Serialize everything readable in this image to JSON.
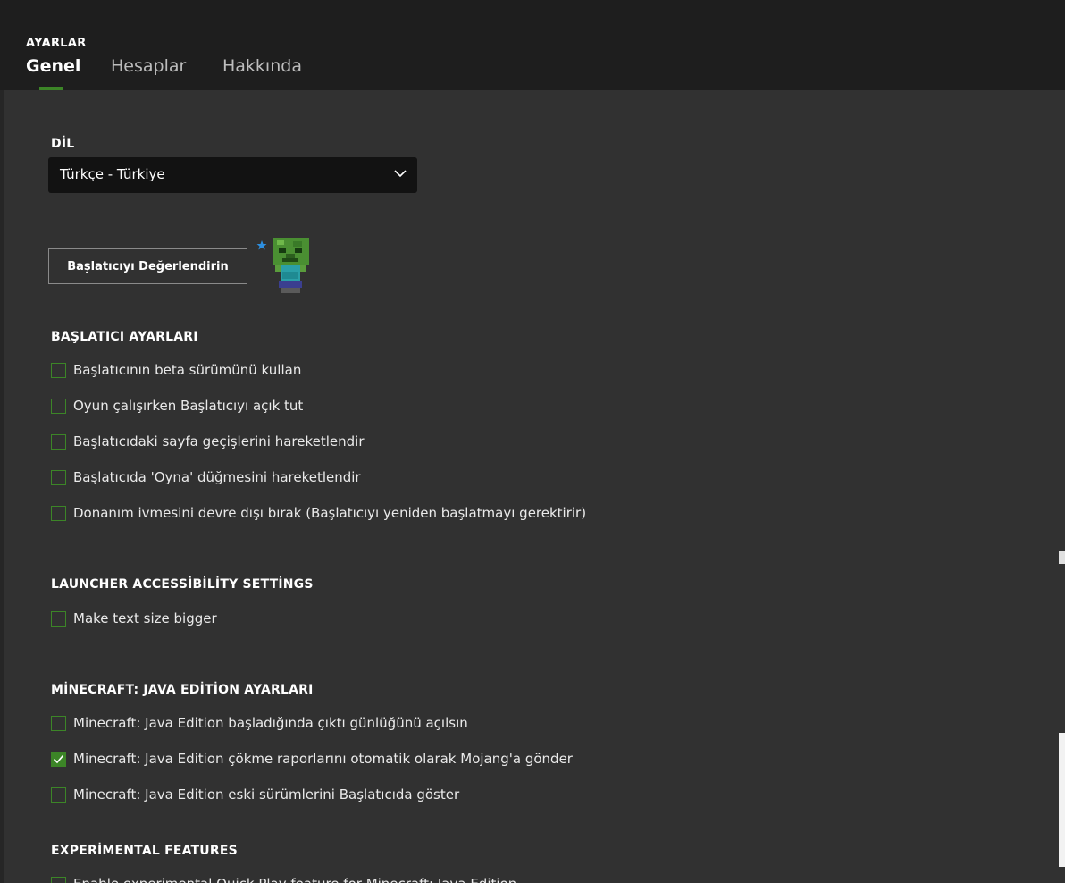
{
  "header": {
    "section_caption": "AYARLAR",
    "tabs": [
      {
        "label": "Genel",
        "active": true
      },
      {
        "label": "Hesaplar",
        "active": false
      },
      {
        "label": "Hakkında",
        "active": false
      }
    ]
  },
  "language": {
    "heading": "DİL",
    "selected": "Türkçe - Türkiye",
    "icon": "chevron-down-icon"
  },
  "rate_button": {
    "label": "Başlatıcıyı Değerlendirin",
    "icon": "zombie-mascot-icon"
  },
  "launcher_settings": {
    "heading": "BAŞLATICI AYARLARI",
    "options": [
      {
        "label": "Başlatıcının beta sürümünü kullan",
        "checked": false
      },
      {
        "label": "Oyun çalışırken Başlatıcıyı açık tut",
        "checked": false
      },
      {
        "label": "Başlatıcıdaki sayfa geçişlerini hareketlendir",
        "checked": false
      },
      {
        "label": "Başlatıcıda 'Oyna' düğmesini hareketlendir",
        "checked": false
      },
      {
        "label": "Donanım ivmesini devre dışı bırak (Başlatıcıyı yeniden başlatmayı gerektirir)",
        "checked": false
      }
    ]
  },
  "accessibility": {
    "heading": "LAUNCHER ACCESSİBİLİTY SETTİNGS",
    "options": [
      {
        "label": "Make text size bigger",
        "checked": false
      }
    ]
  },
  "java_settings": {
    "heading": "MİNECRAFT: JAVA EDİTİON AYARLARI",
    "options": [
      {
        "label": "Minecraft: Java Edition başladığında çıktı günlüğünü açılsın",
        "checked": false
      },
      {
        "label": "Minecraft: Java Edition çökme raporlarını otomatik olarak Mojang'a gönder",
        "checked": true
      },
      {
        "label": "Minecraft: Java Edition eski sürümlerini Başlatıcıda göster",
        "checked": false
      }
    ]
  },
  "experimental": {
    "heading": "EXPERİMENTAL FEATURES",
    "options": [
      {
        "label": "Enable experimental Quick Play feature for Minecraft: Java Edition",
        "checked": false
      }
    ]
  },
  "colors": {
    "accent": "#3c8527",
    "content_bg": "#313131",
    "header_bg": "#1e1e1e",
    "dropdown_bg": "#121212"
  }
}
